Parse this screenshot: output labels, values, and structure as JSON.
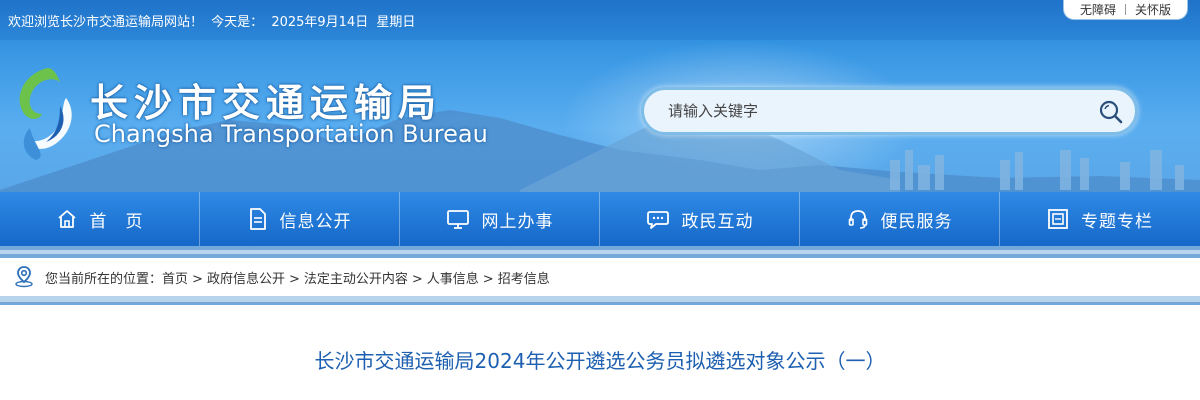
{
  "topbar": {
    "welcome": "欢迎浏览长沙市交通运输局网站！",
    "today_label": "今天是：",
    "date": "2025年9月14日",
    "weekday": "星期日",
    "accessibility": [
      "无障碍",
      "关怀版"
    ]
  },
  "header": {
    "site_name_cn": "长沙市交通运输局",
    "site_name_en": "Changsha Transportation Bureau",
    "logo_icon": "bureau-logo-icon"
  },
  "search": {
    "placeholder": "请输入关键字",
    "icon": "search-icon"
  },
  "nav": {
    "items": [
      {
        "label": "首　页",
        "icon": "home-icon"
      },
      {
        "label": "信息公开",
        "icon": "document-icon"
      },
      {
        "label": "网上办事",
        "icon": "monitor-icon"
      },
      {
        "label": "政民互动",
        "icon": "chat-icon"
      },
      {
        "label": "便民服务",
        "icon": "headset-icon"
      },
      {
        "label": "专题专栏",
        "icon": "frame-icon"
      }
    ]
  },
  "breadcrumb": {
    "prefix": "您当前所在的位置：",
    "items": [
      "首页",
      "政府信息公开",
      "法定主动公开内容",
      "人事信息",
      "招考信息"
    ],
    "icon": "location-pin-icon"
  },
  "article": {
    "title": "长沙市交通运输局2024年公开遴选公务员拟遴选对象公示（一）"
  },
  "colors": {
    "nav_bg": "#1f78d6",
    "title": "#1d5fb0",
    "banner": "#4aa3ec"
  }
}
